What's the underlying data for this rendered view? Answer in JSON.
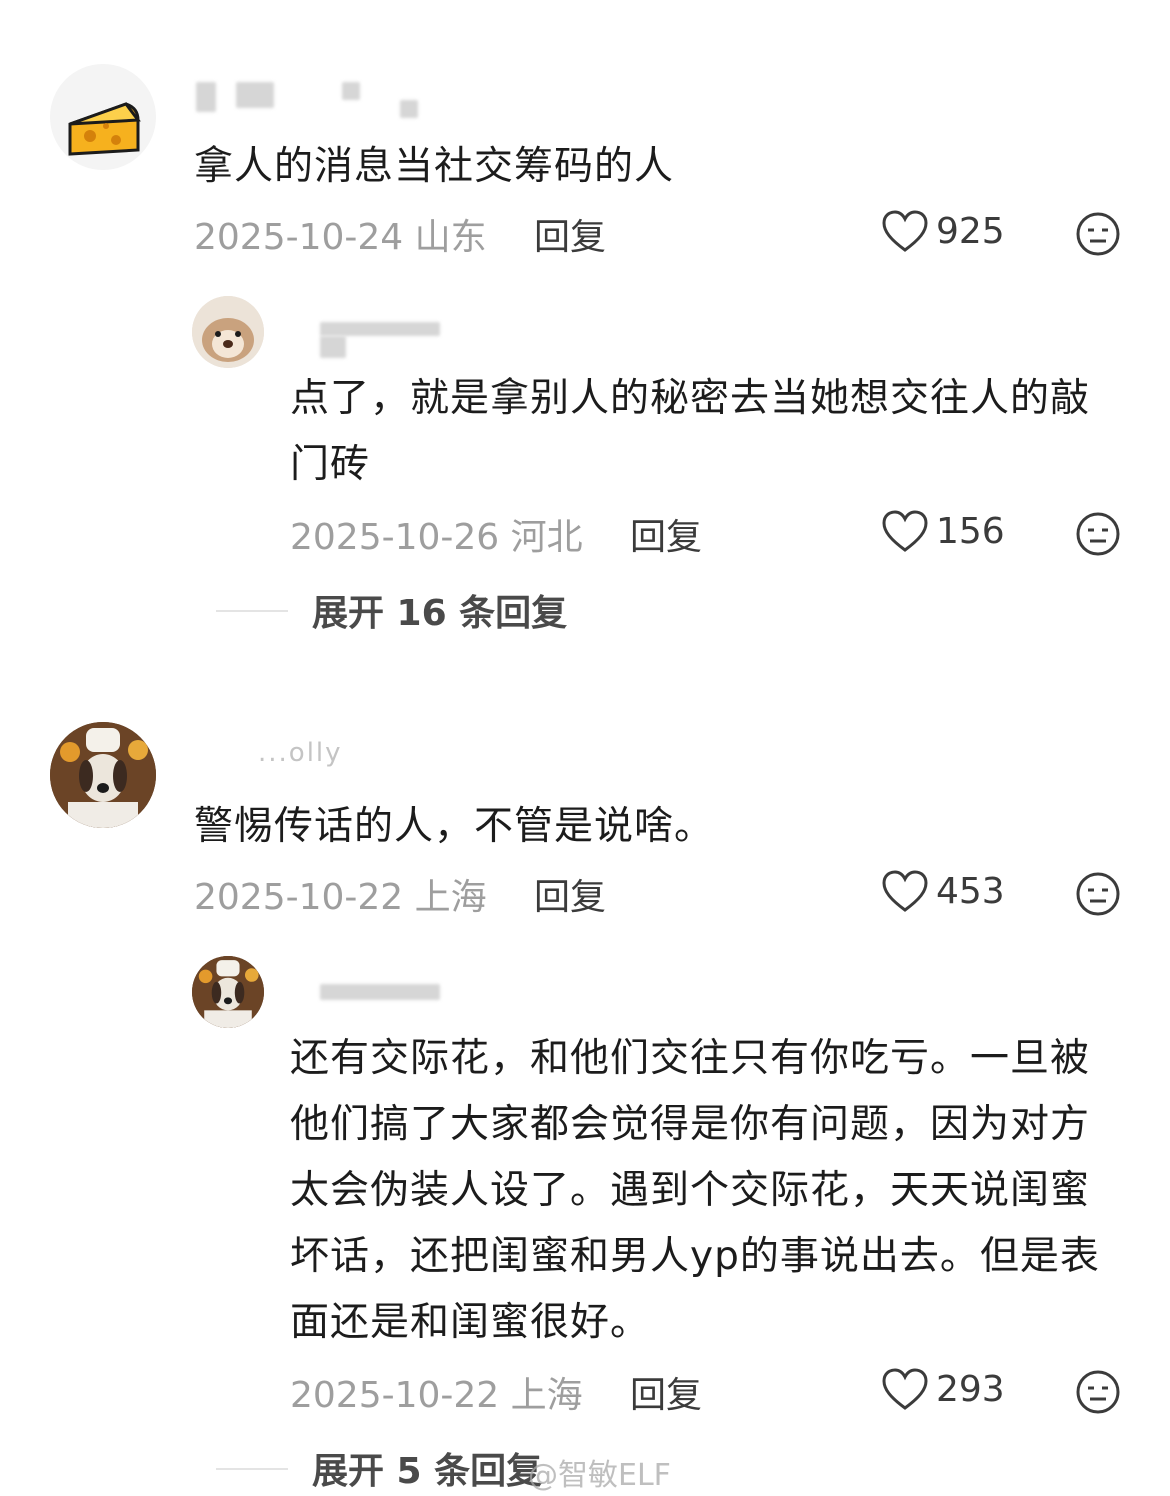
{
  "comments": [
    {
      "text": "拿人的消息当社交筹码的人",
      "date": "2025-10-24",
      "location": "山东",
      "reply_label": "回复",
      "likes": "925",
      "avatar_icon": "cheese-icon"
    },
    {
      "text": "点了，就是拿别人的秘密去当她想交往人的敲门砖",
      "date": "2025-10-26",
      "location": "河北",
      "reply_label": "回复",
      "likes": "156",
      "avatar_icon": "hamster-icon"
    },
    {
      "expand_label": "展开 16 条回复"
    },
    {
      "username": "...olly",
      "text": "警惕传话的人，不管是说啥。",
      "date": "2025-10-22",
      "location": "上海",
      "reply_label": "回复",
      "likes": "453",
      "avatar_icon": "dog-chef-icon"
    },
    {
      "text": "还有交际花，和他们交往只有你吃亏。一旦被他们搞了大家都会觉得是你有问题，因为对方太会伪装人设了。遇到个交际花，天天说闺蜜坏话，还把闺蜜和男人yp的事说出去。但是表面还是和闺蜜很好。",
      "date": "2025-10-22",
      "location": "上海",
      "reply_label": "回复",
      "likes": "293",
      "avatar_icon": "dog-chef-icon"
    },
    {
      "expand_label": "展开 5 条回复"
    }
  ],
  "watermark": "@智敏ELF",
  "colors": {
    "meta": "#9e9e9e",
    "text": "#1c1c1c",
    "reply": "#3b3b3b"
  }
}
